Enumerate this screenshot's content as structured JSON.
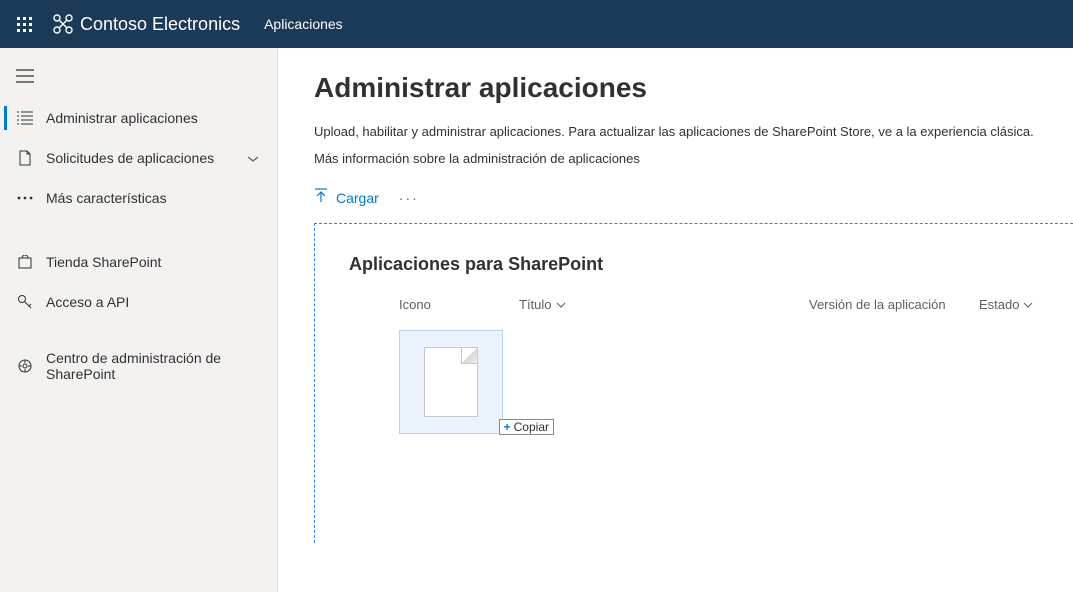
{
  "header": {
    "brand": "Contoso Electronics",
    "app": "Aplicaciones"
  },
  "sidebar": {
    "items": [
      {
        "label": "Administrar aplicaciones"
      },
      {
        "label": "Solicitudes de aplicaciones"
      },
      {
        "label": "Más características"
      },
      {
        "label": "Tienda SharePoint"
      },
      {
        "label": "Acceso a API"
      },
      {
        "label": "Centro de administración de SharePoint"
      }
    ]
  },
  "main": {
    "title": "Administrar aplicaciones",
    "description": "Upload, habilitar y administrar aplicaciones. Para actualizar las aplicaciones de SharePoint Store, ve a la experiencia clásica.",
    "moreinfo": "Más información sobre la administración de aplicaciones",
    "upload_label": "Cargar",
    "section_title": "Aplicaciones para SharePoint",
    "columns": {
      "icon": "Icono",
      "title": "Título",
      "version": "Versión de la aplicación",
      "state": "Estado"
    },
    "drop_hint": "Copiar"
  }
}
